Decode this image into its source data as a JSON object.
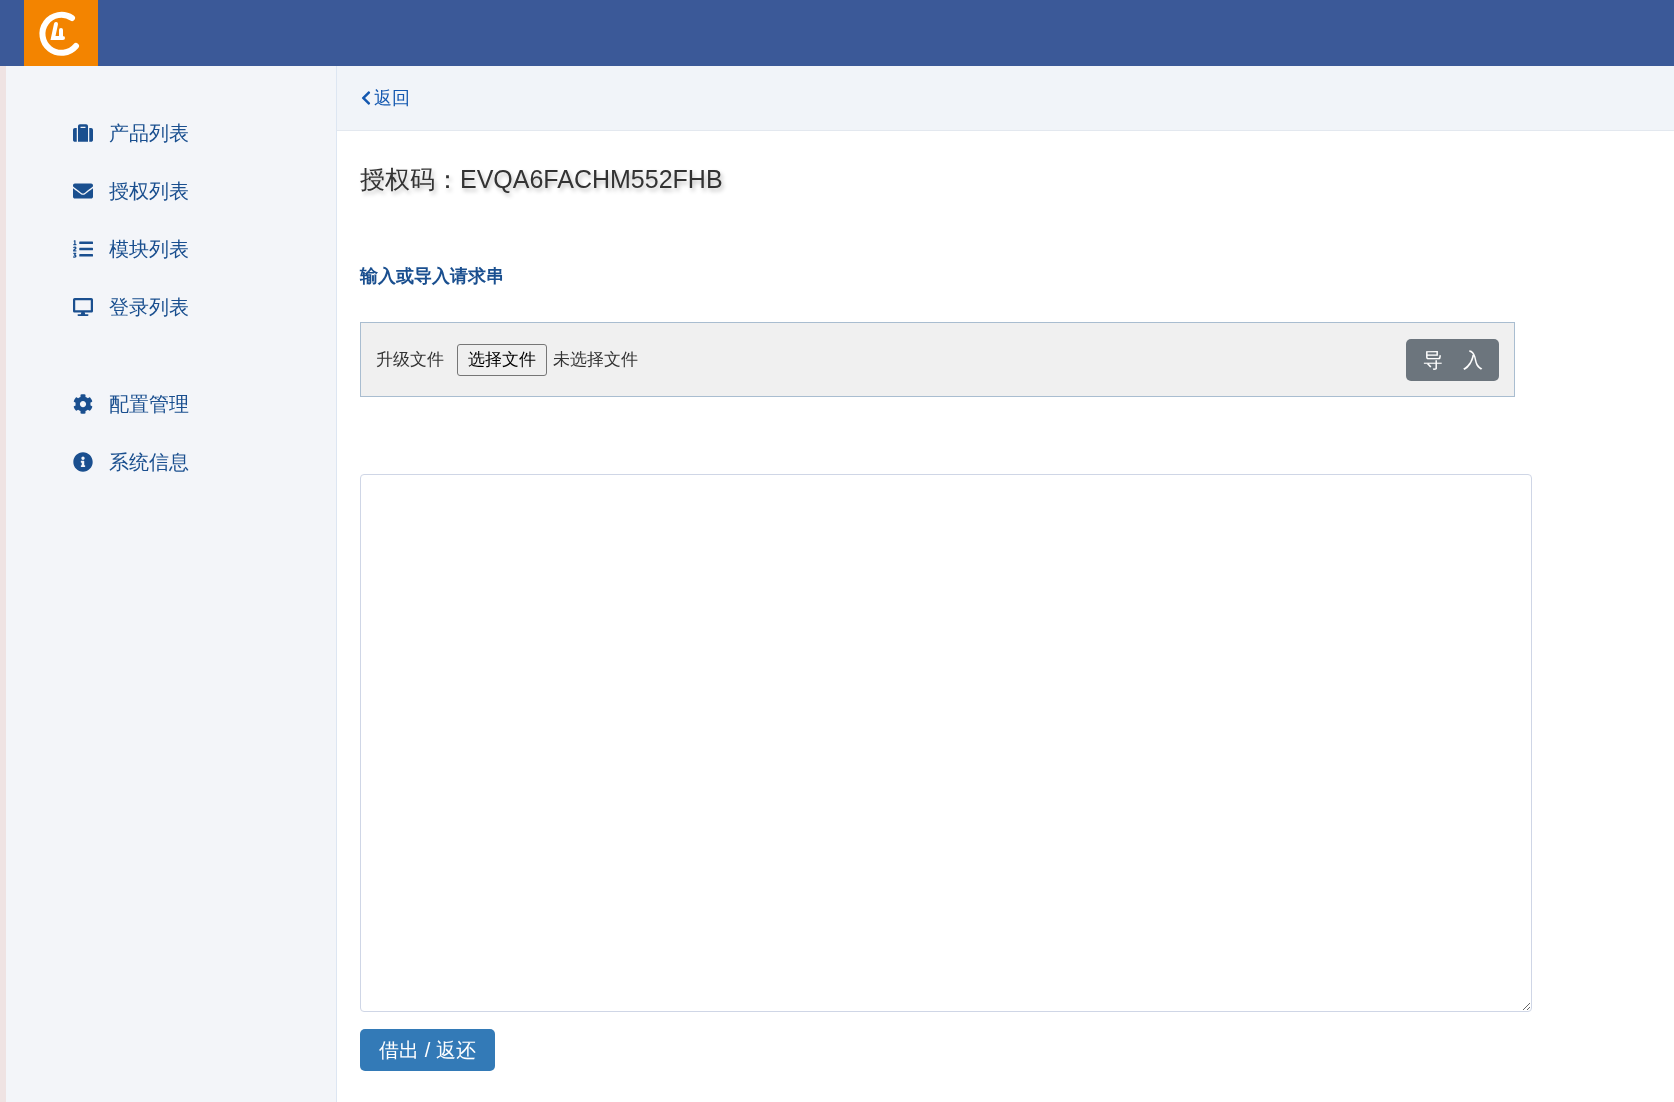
{
  "sidebar": {
    "groups": [
      {
        "items": [
          {
            "label": "产品列表"
          },
          {
            "label": "授权列表"
          },
          {
            "label": "模块列表"
          },
          {
            "label": "登录列表"
          }
        ]
      },
      {
        "items": [
          {
            "label": "配置管理"
          },
          {
            "label": "系统信息"
          }
        ]
      }
    ]
  },
  "back_link": {
    "label": "返回"
  },
  "title": "授权码：EVQA6FACHM552FHB",
  "section_heading": "输入或导入请求串",
  "upload": {
    "label": "升级文件",
    "choose_button": "选择文件",
    "file_status": "未选择文件",
    "import_button": "导　入"
  },
  "submit_button": "借出 / 返还"
}
